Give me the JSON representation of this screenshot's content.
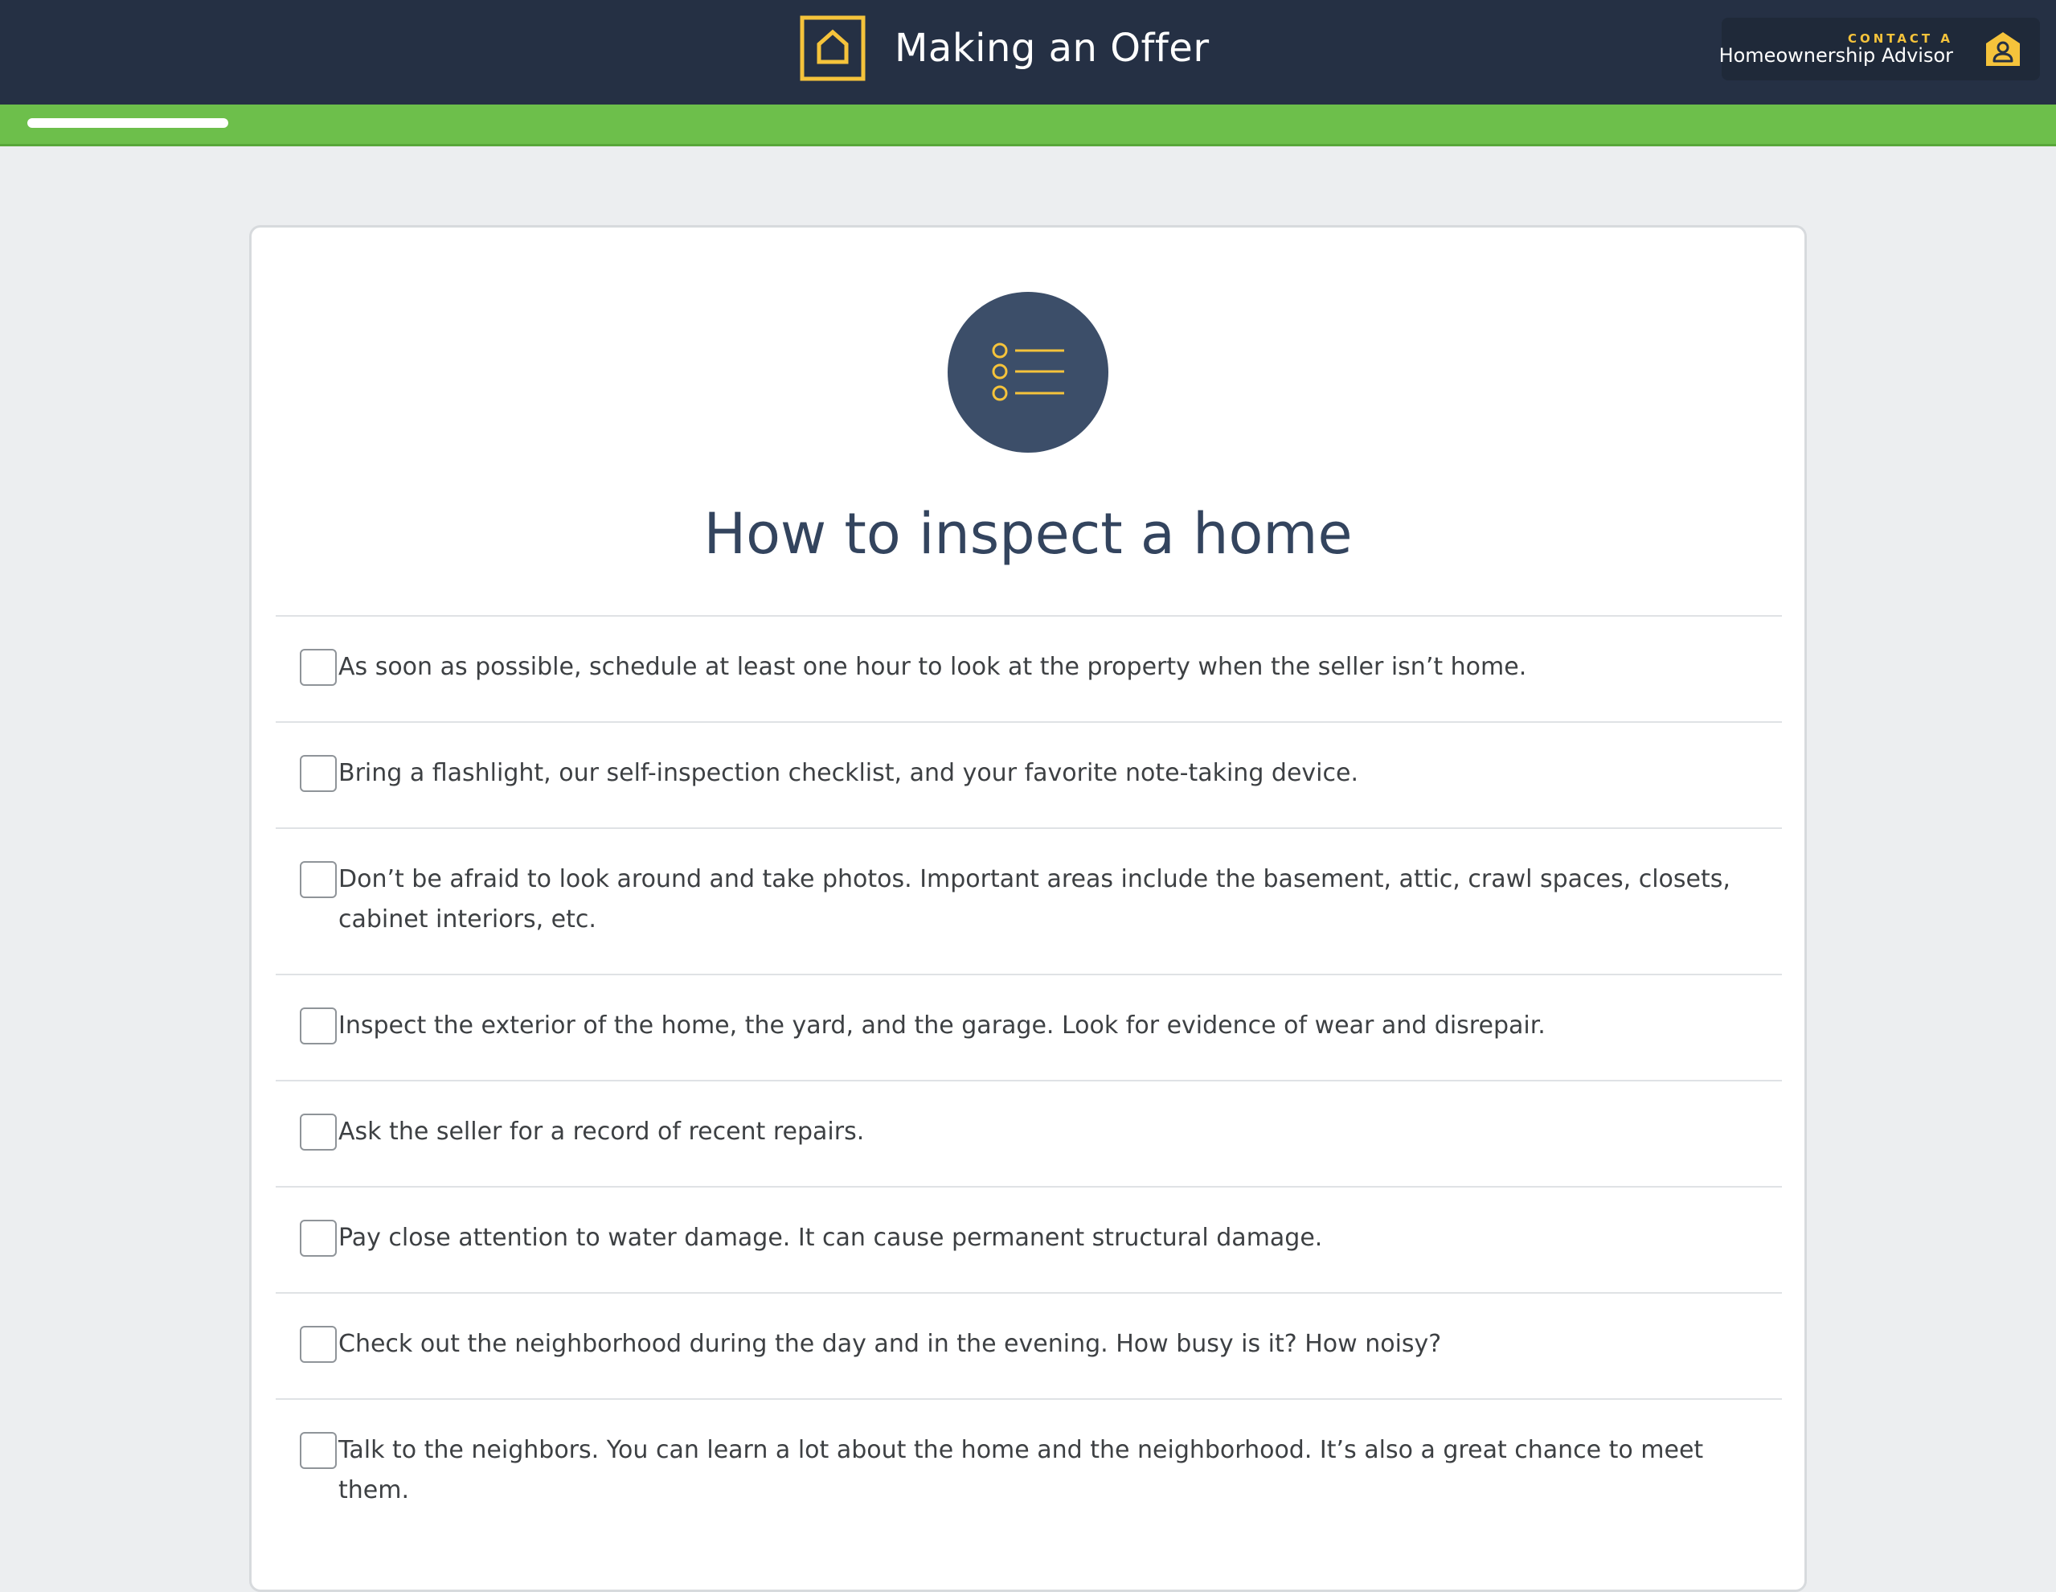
{
  "header": {
    "title": "Making an Offer",
    "logo_icon": "house-outline-icon",
    "advisor": {
      "eyebrow": "CONTACT A",
      "label": "Homeownership Advisor",
      "icon": "advisor-person-icon"
    }
  },
  "progress": {
    "fraction": 0.1
  },
  "card": {
    "icon": "checklist-icon",
    "title": "How to inspect a home",
    "items": [
      "As soon as possible, schedule at least one hour to look at the property when the seller isn’t home.",
      "Bring a flashlight, our self-inspection checklist, and your favorite note-taking device.",
      "Don’t be afraid to look around and take photos. Important areas include the basement, attic, crawl spaces, closets, cabinet interiors, etc.",
      "Inspect the exterior of the home, the yard, and the garage. Look for evidence of wear and disrepair.",
      "Ask the seller for a record of recent repairs.",
      "Pay close attention to water damage. It can cause permanent structural damage.",
      "Check out the neighborhood during the day and in the evening. How busy is it? How noisy?",
      "Talk to the neighbors. You can learn a lot about the home and the neighborhood. It’s also a great chance to meet them."
    ]
  },
  "colors": {
    "header_bg": "#253044",
    "accent_yellow": "#f5c33b",
    "progress_green": "#6dbf4b",
    "icon_circle": "#3c4e69",
    "title_text": "#33445e"
  }
}
